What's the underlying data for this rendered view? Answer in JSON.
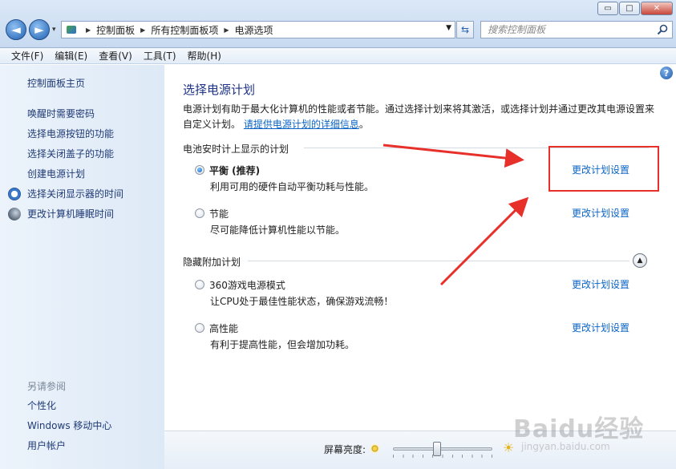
{
  "window": {
    "minimize": "▭",
    "maximize": "□",
    "close": "✕"
  },
  "nav": {
    "back": "◄",
    "forward": "►",
    "dropdown": "▾"
  },
  "breadcrumb": [
    "控制面板",
    "所有控制面板项",
    "电源选项"
  ],
  "search": {
    "placeholder": "搜索控制面板"
  },
  "menu": [
    "文件(F)",
    "编辑(E)",
    "查看(V)",
    "工具(T)",
    "帮助(H)"
  ],
  "sidebar": {
    "home": "控制面板主页",
    "items": [
      {
        "label": "唤醒时需要密码",
        "icon": ""
      },
      {
        "label": "选择电源按钮的功能",
        "icon": ""
      },
      {
        "label": "选择关闭盖子的功能",
        "icon": ""
      },
      {
        "label": "创建电源计划",
        "icon": ""
      },
      {
        "label": "选择关闭显示器的时间",
        "icon": "clock-icon"
      },
      {
        "label": "更改计算机睡眠时间",
        "icon": "moon-icon"
      }
    ],
    "see_also_title": "另请参阅",
    "see_also": [
      "个性化",
      "Windows 移动中心",
      "用户帐户"
    ]
  },
  "main": {
    "title": "选择电源计划",
    "desc_text": "电源计划有助于最大化计算机的性能或者节能。通过选择计划来将其激活，或选择计划并通过更改其电源设置来自定义计划。",
    "desc_link": "请提供电源计划的详细信息",
    "group1": "电池安时计上显示的计划",
    "group2": "隐藏附加计划",
    "change_label": "更改计划设置",
    "plans": [
      {
        "name": "平衡 (推荐)",
        "desc": "利用可用的硬件自动平衡功耗与性能。",
        "selected": true
      },
      {
        "name": "节能",
        "desc": "尽可能降低计算机性能以节能。",
        "selected": false
      },
      {
        "name": "360游戏电源模式",
        "desc": "让CPU处于最佳性能状态，确保游戏流畅！",
        "selected": false
      },
      {
        "name": "高性能",
        "desc": "有利于提高性能，但会增加功耗。",
        "selected": false
      }
    ]
  },
  "brightness": {
    "label": "屏幕亮度:",
    "value_fraction": 0.44
  },
  "watermark": {
    "logo": "Baidu经验",
    "url": "jingyan.baidu.com"
  },
  "colors": {
    "accent_link": "#0b64c6",
    "highlight": "#e8302a"
  }
}
